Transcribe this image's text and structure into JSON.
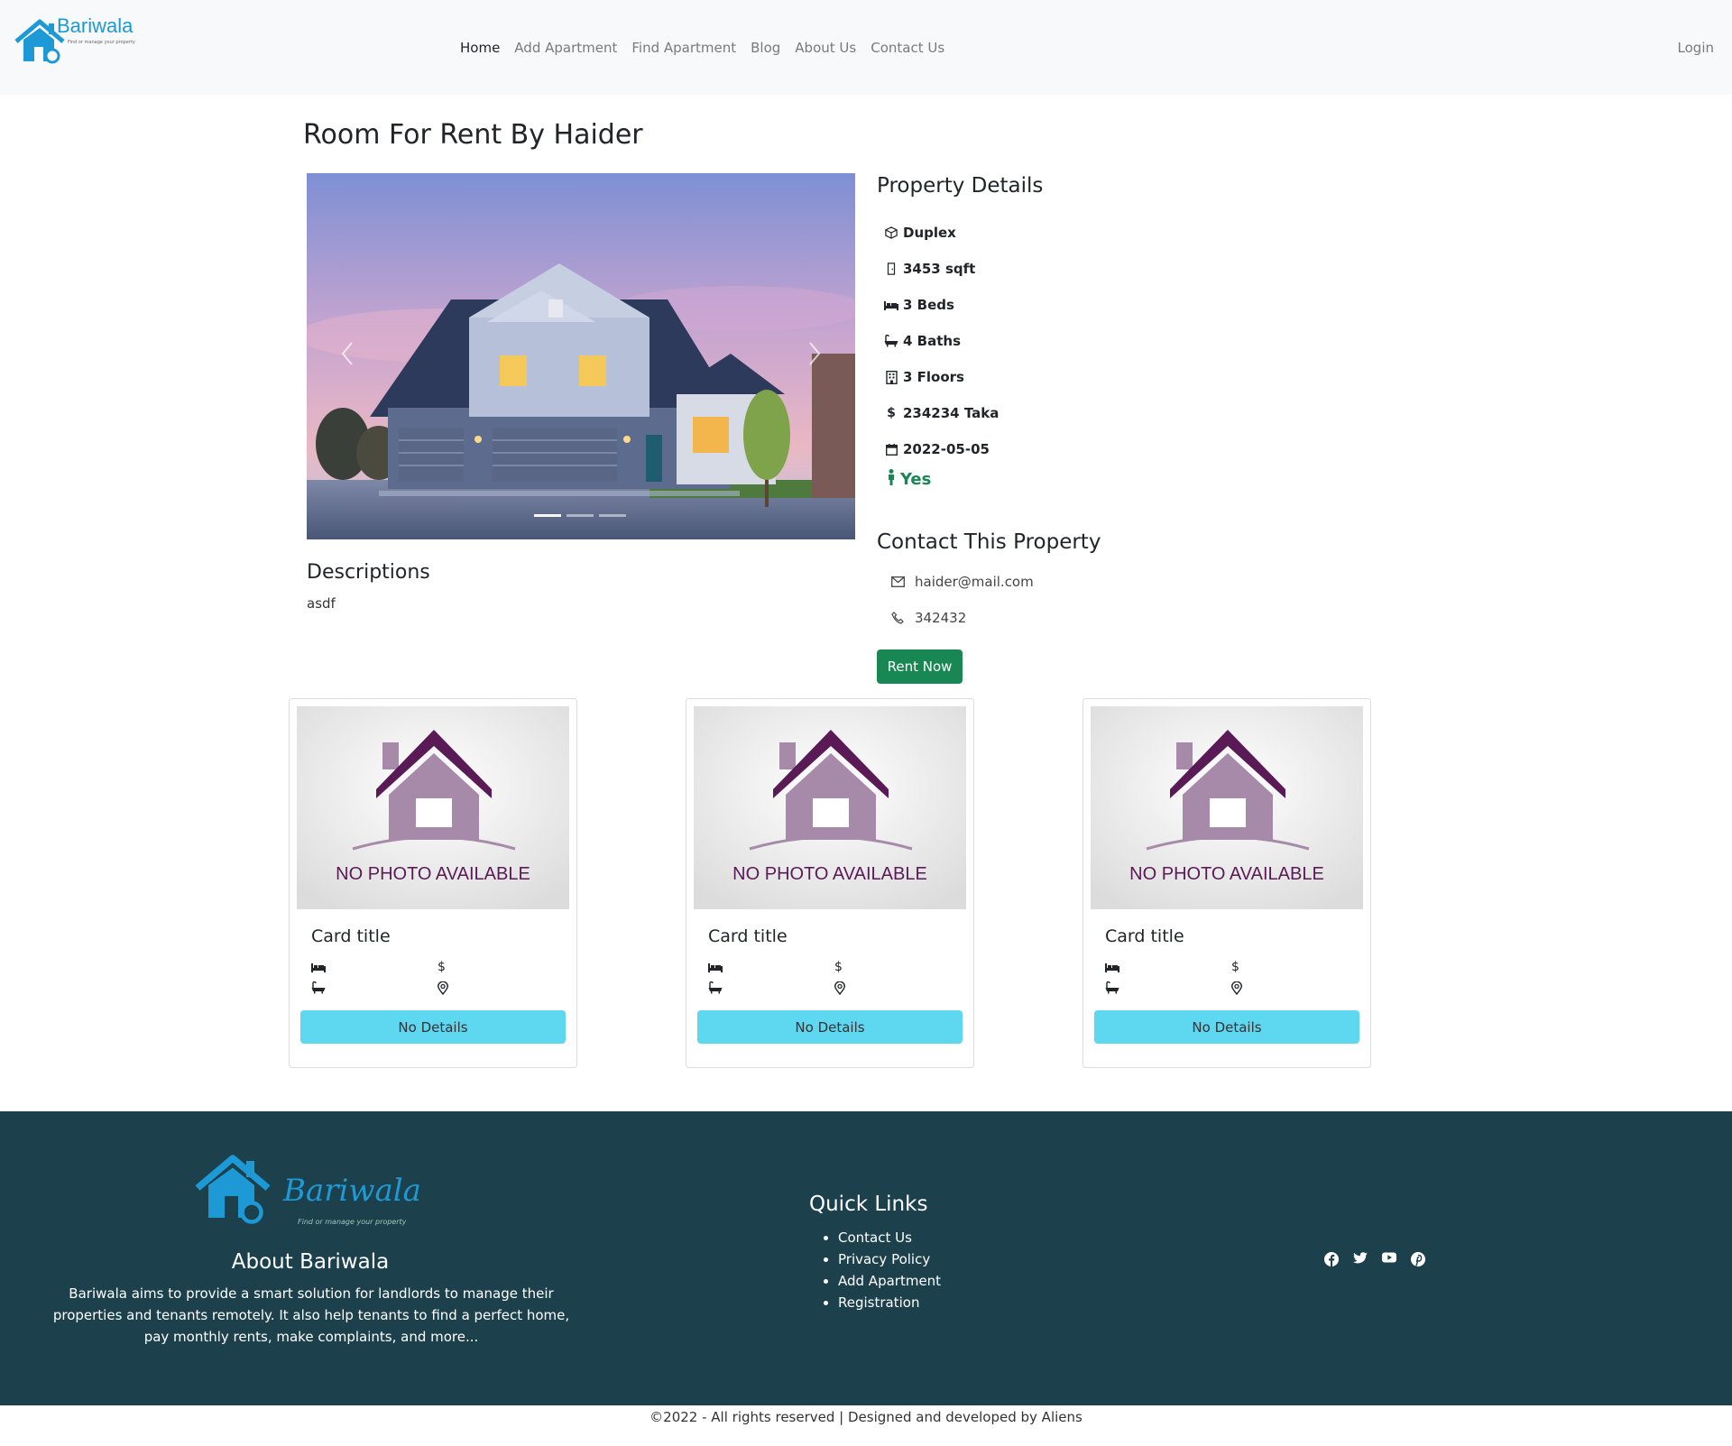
{
  "nav": {
    "brand": "Bariwala",
    "tagline": "Find or manage your property",
    "links": [
      "Home",
      "Add Apartment",
      "Find Apartment",
      "Blog",
      "About Us",
      "Contact Us"
    ],
    "active": "Home",
    "login": "Login"
  },
  "listing": {
    "title": "Room For Rent By Haider",
    "description_title": "Descriptions",
    "description": "asdf",
    "details_title": "Property Details",
    "details": {
      "type": "Duplex",
      "size": "3453 sqft",
      "beds": "3 Beds",
      "baths": "4 Baths",
      "floors": "3 Floors",
      "price": "234234 Taka",
      "date": "2022-05-05"
    },
    "available": "Yes",
    "contact_title": "Contact This Property",
    "email": "haider@mail.com",
    "phone": "342432",
    "rent_button": "Rent Now"
  },
  "carousel": {
    "slide_count": 3,
    "active_slide": 1
  },
  "cards": [
    {
      "image_text": "NO PHOTO AVAILABLE",
      "title": "Card title",
      "button": "No Details"
    },
    {
      "image_text": "NO PHOTO AVAILABLE",
      "title": "Card title",
      "button": "No Details"
    },
    {
      "image_text": "NO PHOTO AVAILABLE",
      "title": "Card title",
      "button": "No Details"
    }
  ],
  "footer": {
    "brand": "Bariwala",
    "tagline": "Find or manage your property",
    "about_title": "About Bariwala",
    "about_text": "Bariwala aims to provide a smart solution for landlords to manage their properties and tenants remotely. It also help tenants to find a perfect home, pay monthly rents, make complaints, and more...",
    "quick_links_title": "Quick Links",
    "quick_links": [
      "Contact Us",
      "Privacy Policy",
      "Add Apartment",
      "Registration"
    ],
    "social": [
      "facebook-icon",
      "twitter-icon",
      "youtube-icon",
      "pinterest-icon"
    ],
    "copyright": "©2022 - All rights reserved | Designed and developed by Aliens"
  },
  "colors": {
    "brand": "#1d9ad6",
    "success": "#198754",
    "info": "#5ed7f0",
    "footer_bg": "#1c404c"
  }
}
